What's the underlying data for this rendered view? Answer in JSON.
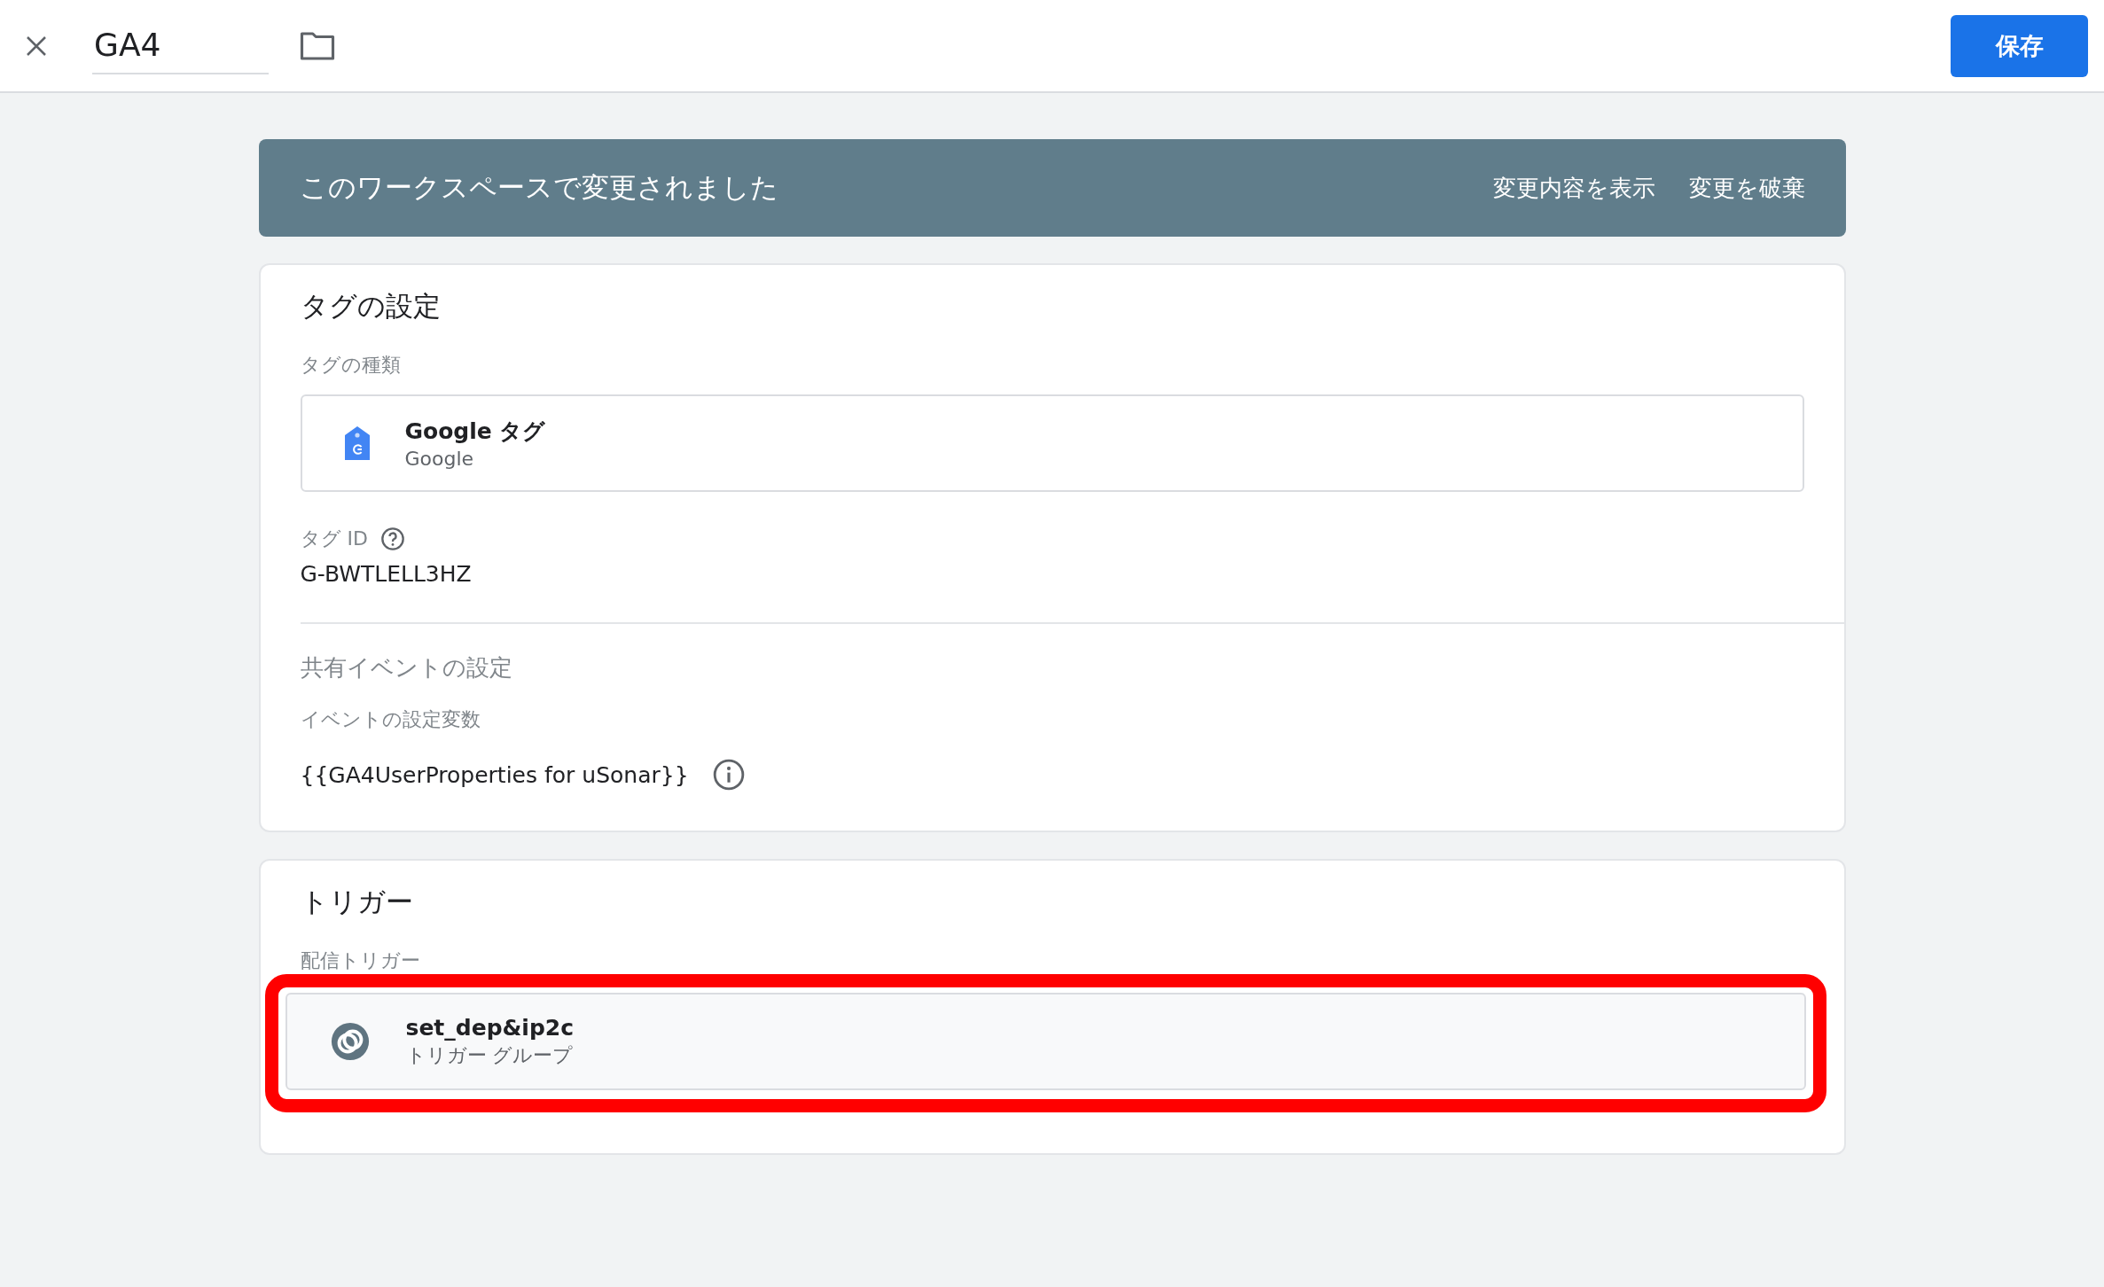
{
  "top_bar": {
    "title": "GA4",
    "save_button": "保存"
  },
  "banner": {
    "message": "このワークスペースで変更されました",
    "actions": [
      "変更内容を表示",
      "変更を破棄"
    ]
  },
  "tag_config": {
    "heading": "タグの設定",
    "type_label": "タグの種類",
    "tag_type": {
      "name": "Google タグ",
      "vendor": "Google"
    },
    "tag_id_label": "タグ ID",
    "tag_id": "G-BWTLELL3HZ",
    "shared_heading": "共有イベントの設定",
    "variable_label": "イベントの設定変数",
    "variable": "{{GA4UserProperties for uSonar}}"
  },
  "trigger": {
    "heading": "トリガー",
    "label": "配信トリガー",
    "items": [
      {
        "name": "set_dep&ip2c",
        "type": "トリガー グループ",
        "highlighted": true
      }
    ]
  }
}
